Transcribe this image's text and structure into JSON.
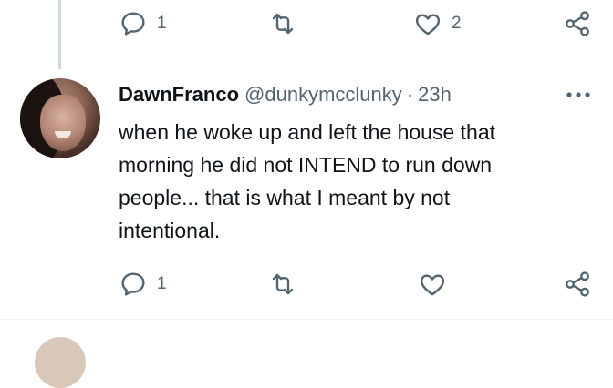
{
  "prev_actions": {
    "reply_count": "1",
    "retweet_count": "",
    "like_count": "2"
  },
  "tweet": {
    "display_name": "DawnFranco",
    "handle": "@dunkymcclunky",
    "separator": "·",
    "time": "23h",
    "text": "when he woke up and left the house that\nmorning he did not INTEND to run down\npeople... that is what I meant by not\nintentional.",
    "actions": {
      "reply_count": "1",
      "retweet_count": "",
      "like_count": ""
    }
  },
  "icons": {
    "reply": "reply-icon",
    "retweet": "retweet-icon",
    "like": "heart-icon",
    "share": "share-icon",
    "more": "more-options-icon"
  },
  "colors": {
    "text": "#0f1419",
    "secondary": "#536471",
    "thread_line": "#cfd9de",
    "divider": "#eff3f4"
  }
}
